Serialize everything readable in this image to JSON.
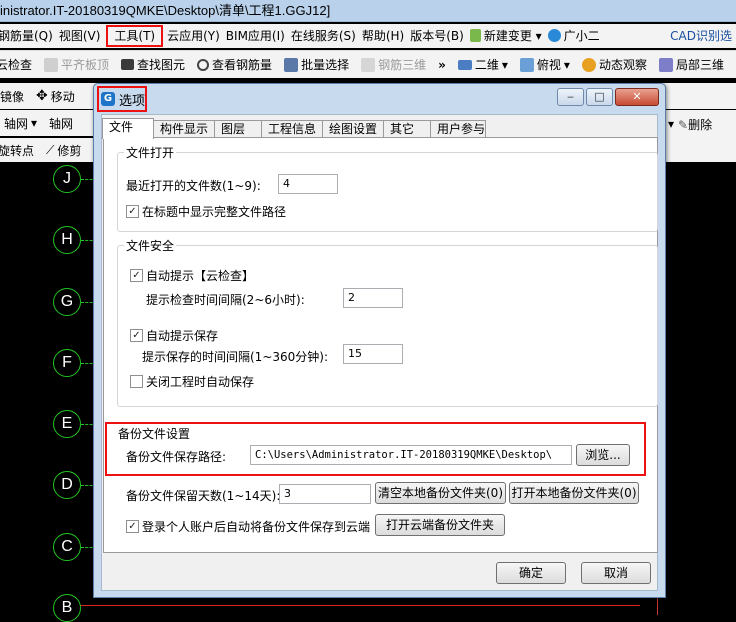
{
  "app": {
    "title": "inistrator.IT-20180319QMKE\\Desktop\\清单\\工程1.GGJ12]",
    "menu": [
      "钢筋量(Q)",
      "视图(V)",
      "工具(T)",
      "云应用(Y)",
      "BIM应用(I)",
      "在线服务(S)",
      "帮助(H)",
      "版本号(B)",
      "新建变更",
      "广小二",
      "CAD识别选"
    ],
    "toolbar1": [
      "云检查",
      "平齐板顶",
      "查找图元",
      "查看钢筋量",
      "批量选择",
      "钢筋三维",
      "二维",
      "俯视",
      "动态观察",
      "局部三维"
    ],
    "toolbar2": [
      "镜像",
      "移动"
    ],
    "toolbar3": [
      "轴网",
      "轴网"
    ],
    "toolbar4": [
      "旋转点",
      "修剪"
    ],
    "right_strip": "删除"
  },
  "axes": [
    "J",
    "H",
    "G",
    "F",
    "E",
    "D",
    "C",
    "B"
  ],
  "dialog": {
    "title": "选项",
    "tabs": [
      "文件",
      "构件显示",
      "图层",
      "工程信息",
      "绘图设置",
      "其它",
      "用户参与"
    ],
    "file_open": {
      "legend": "文件打开",
      "recent_label": "最近打开的文件数(1~9):",
      "recent_value": "4",
      "show_full_path": "在标题中显示完整文件路径"
    },
    "file_security": {
      "legend": "文件安全",
      "auto_prompt": "自动提示【云检查】",
      "check_interval_label": "提示检查时间间隔(2~6小时):",
      "check_interval_value": "2",
      "auto_save_prompt": "自动提示保存",
      "save_interval_label": "提示保存的时间间隔(1~360分钟):",
      "save_interval_value": "15",
      "auto_save_on_close": "关闭工程时自动保存"
    },
    "backup": {
      "legend": "备份文件设置",
      "path_label": "备份文件保存路径:",
      "path_value": "C:\\Users\\Administrator.IT-20180319QMKE\\Desktop\\",
      "browse": "浏览...",
      "days_label": "备份文件保留天数(1~14天):",
      "days_value": "3",
      "clear_local": "清空本地备份文件夹(0)",
      "open_local": "打开本地备份文件夹(0)",
      "cloud_save": "登录个人账户后自动将备份文件保存到云端",
      "open_cloud": "打开云端备份文件夹"
    },
    "ok": "确定",
    "cancel": "取消",
    "win_min": "‒",
    "win_max": "□",
    "win_close": "✕"
  },
  "checks": {
    "show_full_path": "✓",
    "auto_prompt": "✓",
    "auto_save_prompt": "✓",
    "cloud_save": "✓"
  },
  "colors": {
    "axis_green": "#21c521",
    "highlight_red": "#ee1111",
    "dialog_frame": "#c8daee",
    "canvas": "#000000"
  }
}
